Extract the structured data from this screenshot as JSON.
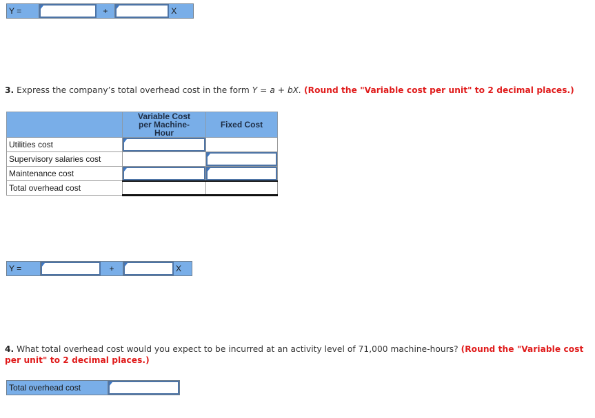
{
  "equation_row_1": {
    "label": "Y =",
    "intercept_value": "",
    "operator": "+",
    "slope_value": "",
    "variable": "X"
  },
  "question_3": {
    "number": "3.",
    "text": " Express the company’s total overhead cost in the form ",
    "formula": "Y = a + bX.",
    "instruction": "(Round the \"Variable cost per unit\" to 2 decimal places.)"
  },
  "overhead_table": {
    "headers": [
      "",
      "Variable Cost per Machine-Hour",
      "Fixed Cost"
    ],
    "rows": [
      {
        "label": "Utilities cost",
        "variable_cost": "",
        "fixed_cost": ""
      },
      {
        "label": "Supervisory salaries cost",
        "variable_cost": "",
        "fixed_cost": ""
      },
      {
        "label": "Maintenance cost",
        "variable_cost": "",
        "fixed_cost": ""
      },
      {
        "label": "Total overhead cost",
        "variable_cost": "",
        "fixed_cost": ""
      }
    ]
  },
  "equation_row_2": {
    "label": "Y =",
    "intercept_value": "",
    "operator": "+",
    "slope_value": "",
    "variable": "X"
  },
  "question_4": {
    "number": "4.",
    "text": " What total overhead cost would you expect to be incurred at an activity level of 71,000 machine-hours? ",
    "instruction": "(Round the \"Variable cost per unit\" to 2 decimal places.)"
  },
  "final_answer": {
    "label": "Total overhead cost",
    "value": ""
  },
  "colors": {
    "cell_fill": "#79aee8",
    "input_border": "#4d74a6",
    "instruction_red": "#e01b1b"
  }
}
